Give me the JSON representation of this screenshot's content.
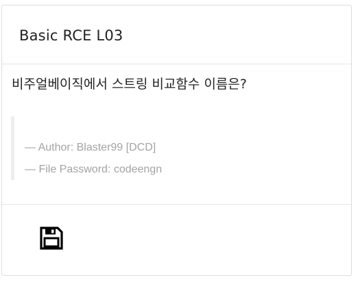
{
  "card": {
    "title": "Basic RCE L03",
    "question": "비주얼베이직에서 스트링 비교함수 이름은?",
    "quote": {
      "author": "— Author: Blaster99 [DCD]",
      "password": "— File Password: codeengn"
    }
  },
  "footer": {
    "download_icon": "floppy-disk-icon"
  },
  "colors": {
    "border": "#dcdcdc",
    "text": "#222222",
    "muted": "#a3a3a3",
    "quote_bar": "#eeeeee"
  }
}
